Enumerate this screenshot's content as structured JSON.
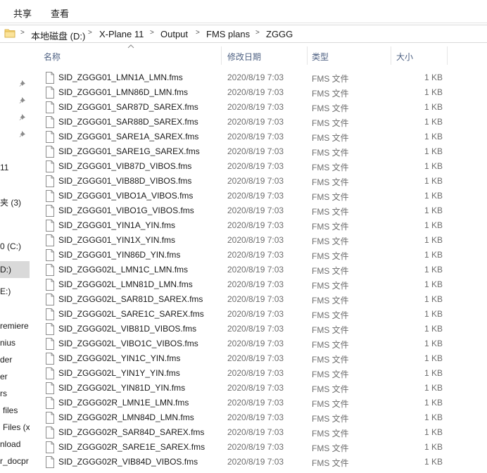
{
  "ribbon": {
    "tabs": [
      "共享",
      "查看"
    ]
  },
  "address": {
    "crumbs": [
      "本地磁盘 (D:)",
      "X-Plane 11",
      "Output",
      "FMS plans",
      "ZGGG"
    ]
  },
  "nav": {
    "items": [
      "11",
      "夹 (3)",
      "0 (C:)",
      "D:)",
      "E:)",
      "remiere",
      "nius",
      "der",
      "er",
      "rs",
      "files",
      "Files (x",
      "nload",
      "r_docpr"
    ]
  },
  "columns": {
    "name": "名称",
    "date": "修改日期",
    "type": "类型",
    "size": "大小"
  },
  "files": [
    {
      "name": "SID_ZGGG01_LMN1A_LMN.fms",
      "date": "2020/8/19 7:03",
      "type": "FMS 文件",
      "size": "1 KB"
    },
    {
      "name": "SID_ZGGG01_LMN86D_LMN.fms",
      "date": "2020/8/19 7:03",
      "type": "FMS 文件",
      "size": "1 KB"
    },
    {
      "name": "SID_ZGGG01_SAR87D_SAREX.fms",
      "date": "2020/8/19 7:03",
      "type": "FMS 文件",
      "size": "1 KB"
    },
    {
      "name": "SID_ZGGG01_SAR88D_SAREX.fms",
      "date": "2020/8/19 7:03",
      "type": "FMS 文件",
      "size": "1 KB"
    },
    {
      "name": "SID_ZGGG01_SARE1A_SAREX.fms",
      "date": "2020/8/19 7:03",
      "type": "FMS 文件",
      "size": "1 KB"
    },
    {
      "name": "SID_ZGGG01_SARE1G_SAREX.fms",
      "date": "2020/8/19 7:03",
      "type": "FMS 文件",
      "size": "1 KB"
    },
    {
      "name": "SID_ZGGG01_VIB87D_VIBOS.fms",
      "date": "2020/8/19 7:03",
      "type": "FMS 文件",
      "size": "1 KB"
    },
    {
      "name": "SID_ZGGG01_VIB88D_VIBOS.fms",
      "date": "2020/8/19 7:03",
      "type": "FMS 文件",
      "size": "1 KB"
    },
    {
      "name": "SID_ZGGG01_VIBO1A_VIBOS.fms",
      "date": "2020/8/19 7:03",
      "type": "FMS 文件",
      "size": "1 KB"
    },
    {
      "name": "SID_ZGGG01_VIBO1G_VIBOS.fms",
      "date": "2020/8/19 7:03",
      "type": "FMS 文件",
      "size": "1 KB"
    },
    {
      "name": "SID_ZGGG01_YIN1A_YIN.fms",
      "date": "2020/8/19 7:03",
      "type": "FMS 文件",
      "size": "1 KB"
    },
    {
      "name": "SID_ZGGG01_YIN1X_YIN.fms",
      "date": "2020/8/19 7:03",
      "type": "FMS 文件",
      "size": "1 KB"
    },
    {
      "name": "SID_ZGGG01_YIN86D_YIN.fms",
      "date": "2020/8/19 7:03",
      "type": "FMS 文件",
      "size": "1 KB"
    },
    {
      "name": "SID_ZGGG02L_LMN1C_LMN.fms",
      "date": "2020/8/19 7:03",
      "type": "FMS 文件",
      "size": "1 KB"
    },
    {
      "name": "SID_ZGGG02L_LMN81D_LMN.fms",
      "date": "2020/8/19 7:03",
      "type": "FMS 文件",
      "size": "1 KB"
    },
    {
      "name": "SID_ZGGG02L_SAR81D_SAREX.fms",
      "date": "2020/8/19 7:03",
      "type": "FMS 文件",
      "size": "1 KB"
    },
    {
      "name": "SID_ZGGG02L_SARE1C_SAREX.fms",
      "date": "2020/8/19 7:03",
      "type": "FMS 文件",
      "size": "1 KB"
    },
    {
      "name": "SID_ZGGG02L_VIB81D_VIBOS.fms",
      "date": "2020/8/19 7:03",
      "type": "FMS 文件",
      "size": "1 KB"
    },
    {
      "name": "SID_ZGGG02L_VIBO1C_VIBOS.fms",
      "date": "2020/8/19 7:03",
      "type": "FMS 文件",
      "size": "1 KB"
    },
    {
      "name": "SID_ZGGG02L_YIN1C_YIN.fms",
      "date": "2020/8/19 7:03",
      "type": "FMS 文件",
      "size": "1 KB"
    },
    {
      "name": "SID_ZGGG02L_YIN1Y_YIN.fms",
      "date": "2020/8/19 7:03",
      "type": "FMS 文件",
      "size": "1 KB"
    },
    {
      "name": "SID_ZGGG02L_YIN81D_YIN.fms",
      "date": "2020/8/19 7:03",
      "type": "FMS 文件",
      "size": "1 KB"
    },
    {
      "name": "SID_ZGGG02R_LMN1E_LMN.fms",
      "date": "2020/8/19 7:03",
      "type": "FMS 文件",
      "size": "1 KB"
    },
    {
      "name": "SID_ZGGG02R_LMN84D_LMN.fms",
      "date": "2020/8/19 7:03",
      "type": "FMS 文件",
      "size": "1 KB"
    },
    {
      "name": "SID_ZGGG02R_SAR84D_SAREX.fms",
      "date": "2020/8/19 7:03",
      "type": "FMS 文件",
      "size": "1 KB"
    },
    {
      "name": "SID_ZGGG02R_SARE1E_SAREX.fms",
      "date": "2020/8/19 7:03",
      "type": "FMS 文件",
      "size": "1 KB"
    },
    {
      "name": "SID_ZGGG02R_VIB84D_VIBOS.fms",
      "date": "2020/8/19 7:03",
      "type": "FMS 文件",
      "size": "1 KB"
    }
  ],
  "colors": {
    "header_text": "#4d6082",
    "secondary_text": "#6d6d6d",
    "folder": "#f8d775",
    "selected_nav": "#d9d9d9"
  },
  "icons": {
    "folder": "folder-icon",
    "file": "file-icon",
    "pin": "pin-icon",
    "sort": "sort-up-icon"
  }
}
